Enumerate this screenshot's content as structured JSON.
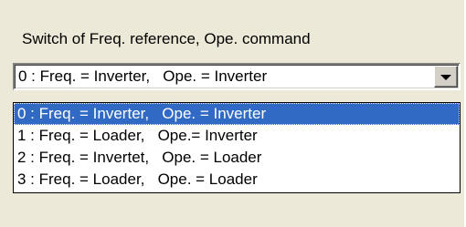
{
  "group": {
    "label": "Switch of Freq. reference, Ope. command"
  },
  "combo": {
    "selected_value": "0 : Freq. = Inverter,   Ope. = Inverter",
    "button_icon": "chevron-down-icon"
  },
  "dropdown": {
    "selected_index": 0,
    "options": [
      "0 : Freq. = Inverter,   Ope. = Inverter",
      "1 : Freq. = Loader,   Ope.= Inverter",
      "2 : Freq. = Invertet,   Ope. = Loader",
      "3 : Freq. = Loader,   Ope. = Loader"
    ]
  },
  "colors": {
    "window_background": "#ece9d8",
    "selection_highlight": "#316ac5",
    "selection_text": "#ffffff"
  }
}
